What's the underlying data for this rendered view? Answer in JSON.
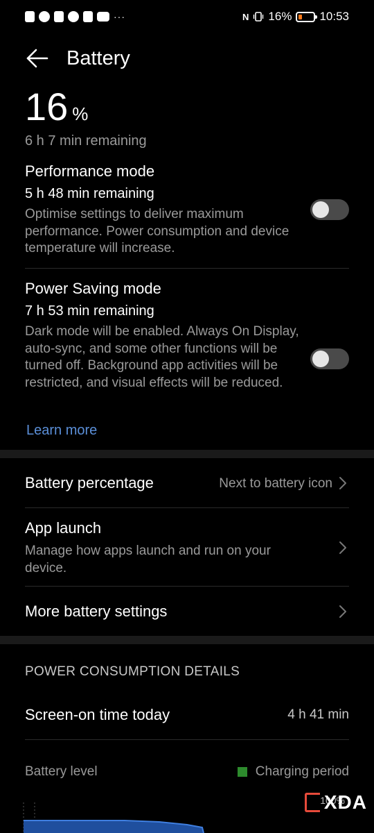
{
  "status_bar": {
    "battery_pct": "16%",
    "time": "10:53",
    "left_icons": [
      "alert-icon",
      "whatsapp-icon",
      "message-icon",
      "messenger-icon",
      "alert-icon",
      "youtube-icon"
    ],
    "nfc": "N",
    "more": "···"
  },
  "header": {
    "title": "Battery"
  },
  "battery": {
    "level": 16,
    "level_unit": "%",
    "remaining": "6 h 7 min remaining"
  },
  "performance_mode": {
    "title": "Performance mode",
    "remaining": "5 h 48 min remaining",
    "description": "Optimise settings to deliver maximum performance. Power consumption and device temperature will increase.",
    "enabled": false
  },
  "power_saving_mode": {
    "title": "Power Saving mode",
    "remaining": "7 h 53 min remaining",
    "description": "Dark mode will be enabled. Always On Display, auto-sync, and some other functions will be turned off. Background app activities will be restricted, and visual effects will be reduced.",
    "enabled": false
  },
  "learn_more": "Learn more",
  "settings": {
    "battery_percentage": {
      "title": "Battery percentage",
      "value": "Next to battery icon"
    },
    "app_launch": {
      "title": "App launch",
      "description": "Manage how apps launch and run on your device."
    },
    "more_settings": {
      "title": "More battery settings"
    }
  },
  "consumption": {
    "header": "POWER CONSUMPTION DETAILS",
    "screen_on_label": "Screen-on time today",
    "screen_on_value": "4 h 41 min",
    "battery_level_label": "Battery level",
    "legend_label": "Charging period",
    "tick_label": "100%"
  },
  "watermark": {
    "text": "XDA"
  },
  "colors": {
    "accent_link": "#5b8fd8",
    "charging_legend": "#2d8b2d",
    "chart_fill": "#1f4f9e",
    "chart_line": "#3f7fe0",
    "battery_low": "#ff7a1a"
  }
}
